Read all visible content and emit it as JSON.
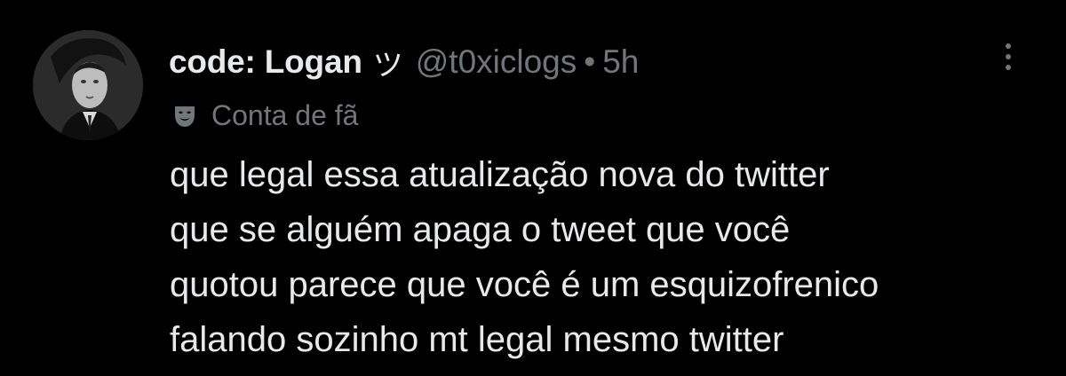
{
  "tweet": {
    "display_name": "code: Logan",
    "name_emoji": "ツ",
    "handle": "@t0xiclogs",
    "separator": "•",
    "timestamp": "5h",
    "badge_label": "Conta de fã",
    "text_lines": [
      "que legal essa atualização nova do twitter",
      "que se alguém apaga o tweet que você",
      "quotou parece que você é um esquizofrenico",
      "falando sozinho mt legal mesmo twitter"
    ]
  },
  "icons": {
    "avatar": "user-avatar-photo",
    "badge": "mask-icon",
    "more": "more-options-icon"
  },
  "colors": {
    "background": "#000000",
    "primary_text": "#e7e9ea",
    "secondary_text": "#71767b"
  }
}
